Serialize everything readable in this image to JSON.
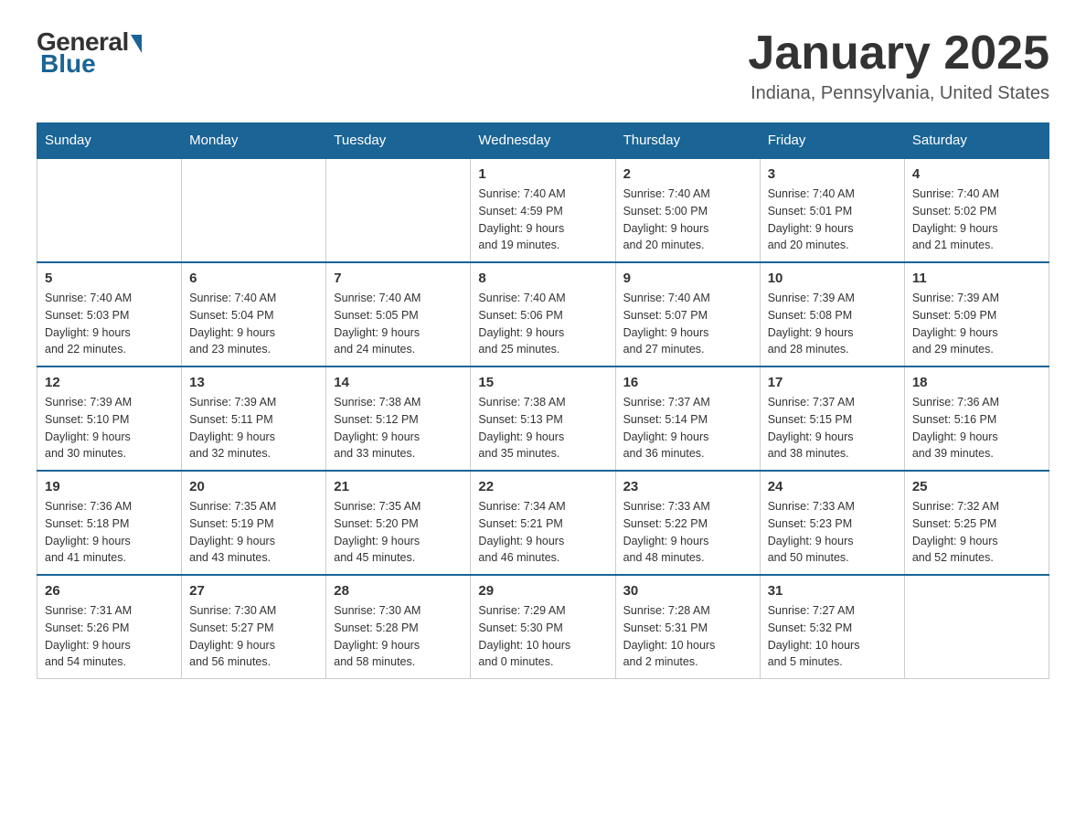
{
  "logo": {
    "general": "General",
    "blue": "Blue"
  },
  "title": {
    "month": "January 2025",
    "location": "Indiana, Pennsylvania, United States"
  },
  "weekdays": [
    "Sunday",
    "Monday",
    "Tuesday",
    "Wednesday",
    "Thursday",
    "Friday",
    "Saturday"
  ],
  "weeks": [
    [
      {
        "day": "",
        "info": ""
      },
      {
        "day": "",
        "info": ""
      },
      {
        "day": "",
        "info": ""
      },
      {
        "day": "1",
        "info": "Sunrise: 7:40 AM\nSunset: 4:59 PM\nDaylight: 9 hours\nand 19 minutes."
      },
      {
        "day": "2",
        "info": "Sunrise: 7:40 AM\nSunset: 5:00 PM\nDaylight: 9 hours\nand 20 minutes."
      },
      {
        "day": "3",
        "info": "Sunrise: 7:40 AM\nSunset: 5:01 PM\nDaylight: 9 hours\nand 20 minutes."
      },
      {
        "day": "4",
        "info": "Sunrise: 7:40 AM\nSunset: 5:02 PM\nDaylight: 9 hours\nand 21 minutes."
      }
    ],
    [
      {
        "day": "5",
        "info": "Sunrise: 7:40 AM\nSunset: 5:03 PM\nDaylight: 9 hours\nand 22 minutes."
      },
      {
        "day": "6",
        "info": "Sunrise: 7:40 AM\nSunset: 5:04 PM\nDaylight: 9 hours\nand 23 minutes."
      },
      {
        "day": "7",
        "info": "Sunrise: 7:40 AM\nSunset: 5:05 PM\nDaylight: 9 hours\nand 24 minutes."
      },
      {
        "day": "8",
        "info": "Sunrise: 7:40 AM\nSunset: 5:06 PM\nDaylight: 9 hours\nand 25 minutes."
      },
      {
        "day": "9",
        "info": "Sunrise: 7:40 AM\nSunset: 5:07 PM\nDaylight: 9 hours\nand 27 minutes."
      },
      {
        "day": "10",
        "info": "Sunrise: 7:39 AM\nSunset: 5:08 PM\nDaylight: 9 hours\nand 28 minutes."
      },
      {
        "day": "11",
        "info": "Sunrise: 7:39 AM\nSunset: 5:09 PM\nDaylight: 9 hours\nand 29 minutes."
      }
    ],
    [
      {
        "day": "12",
        "info": "Sunrise: 7:39 AM\nSunset: 5:10 PM\nDaylight: 9 hours\nand 30 minutes."
      },
      {
        "day": "13",
        "info": "Sunrise: 7:39 AM\nSunset: 5:11 PM\nDaylight: 9 hours\nand 32 minutes."
      },
      {
        "day": "14",
        "info": "Sunrise: 7:38 AM\nSunset: 5:12 PM\nDaylight: 9 hours\nand 33 minutes."
      },
      {
        "day": "15",
        "info": "Sunrise: 7:38 AM\nSunset: 5:13 PM\nDaylight: 9 hours\nand 35 minutes."
      },
      {
        "day": "16",
        "info": "Sunrise: 7:37 AM\nSunset: 5:14 PM\nDaylight: 9 hours\nand 36 minutes."
      },
      {
        "day": "17",
        "info": "Sunrise: 7:37 AM\nSunset: 5:15 PM\nDaylight: 9 hours\nand 38 minutes."
      },
      {
        "day": "18",
        "info": "Sunrise: 7:36 AM\nSunset: 5:16 PM\nDaylight: 9 hours\nand 39 minutes."
      }
    ],
    [
      {
        "day": "19",
        "info": "Sunrise: 7:36 AM\nSunset: 5:18 PM\nDaylight: 9 hours\nand 41 minutes."
      },
      {
        "day": "20",
        "info": "Sunrise: 7:35 AM\nSunset: 5:19 PM\nDaylight: 9 hours\nand 43 minutes."
      },
      {
        "day": "21",
        "info": "Sunrise: 7:35 AM\nSunset: 5:20 PM\nDaylight: 9 hours\nand 45 minutes."
      },
      {
        "day": "22",
        "info": "Sunrise: 7:34 AM\nSunset: 5:21 PM\nDaylight: 9 hours\nand 46 minutes."
      },
      {
        "day": "23",
        "info": "Sunrise: 7:33 AM\nSunset: 5:22 PM\nDaylight: 9 hours\nand 48 minutes."
      },
      {
        "day": "24",
        "info": "Sunrise: 7:33 AM\nSunset: 5:23 PM\nDaylight: 9 hours\nand 50 minutes."
      },
      {
        "day": "25",
        "info": "Sunrise: 7:32 AM\nSunset: 5:25 PM\nDaylight: 9 hours\nand 52 minutes."
      }
    ],
    [
      {
        "day": "26",
        "info": "Sunrise: 7:31 AM\nSunset: 5:26 PM\nDaylight: 9 hours\nand 54 minutes."
      },
      {
        "day": "27",
        "info": "Sunrise: 7:30 AM\nSunset: 5:27 PM\nDaylight: 9 hours\nand 56 minutes."
      },
      {
        "day": "28",
        "info": "Sunrise: 7:30 AM\nSunset: 5:28 PM\nDaylight: 9 hours\nand 58 minutes."
      },
      {
        "day": "29",
        "info": "Sunrise: 7:29 AM\nSunset: 5:30 PM\nDaylight: 10 hours\nand 0 minutes."
      },
      {
        "day": "30",
        "info": "Sunrise: 7:28 AM\nSunset: 5:31 PM\nDaylight: 10 hours\nand 2 minutes."
      },
      {
        "day": "31",
        "info": "Sunrise: 7:27 AM\nSunset: 5:32 PM\nDaylight: 10 hours\nand 5 minutes."
      },
      {
        "day": "",
        "info": ""
      }
    ]
  ]
}
